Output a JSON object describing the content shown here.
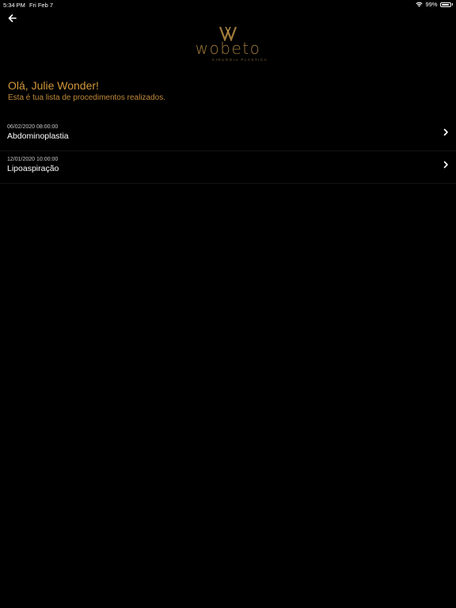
{
  "status_bar": {
    "time": "5:34 PM",
    "date": "Fri Feb 7",
    "battery": "99%",
    "battery_level": 0.99,
    "wifi_icon": "wifi-icon",
    "battery_icon": "battery-icon"
  },
  "header": {
    "back_icon": "arrow-left-icon"
  },
  "logo": {
    "word": "wobeto",
    "sub": "CIRURGIA PLÁSTICA"
  },
  "greeting": "Olá, Julie Wonder!",
  "subtitle": "Esta é tua lista de procedimentos realizados.",
  "procedures": [
    {
      "date": "06/02/2020 08:00:00",
      "name": "Abdominoplastia"
    },
    {
      "date": "12/01/2020 10:00:00",
      "name": "Lipoaspiração"
    }
  ],
  "colors": {
    "background": "#000000",
    "accent": "#d2973b",
    "logo_gold": "#a07a3c"
  }
}
